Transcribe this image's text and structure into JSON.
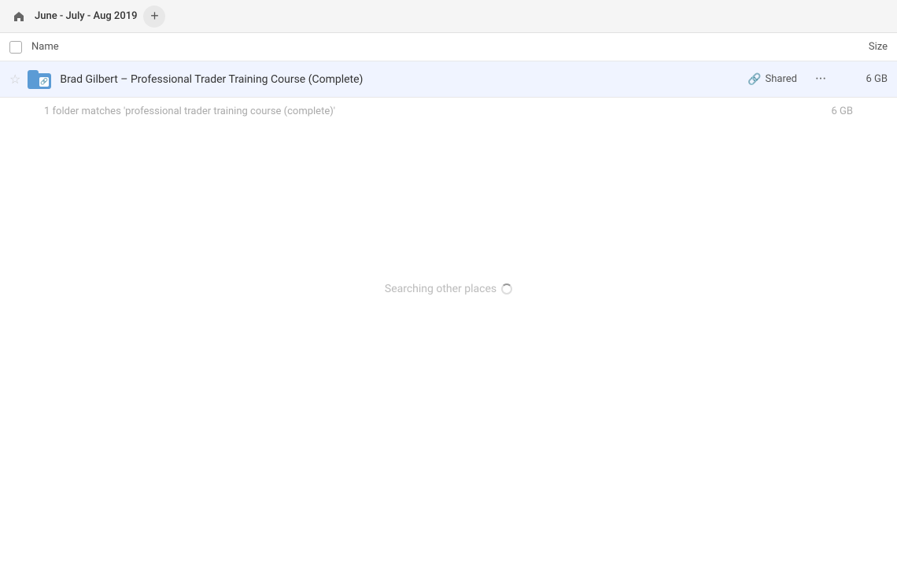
{
  "header": {
    "home_icon": "home",
    "breadcrumb_label": "June - July - Aug 2019",
    "add_button_label": "+"
  },
  "columns": {
    "name_label": "Name",
    "size_label": "Size"
  },
  "file_row": {
    "name": "Brad Gilbert – Professional Trader Training Course (Complete)",
    "shared_label": "Shared",
    "more_label": "···",
    "size": "6 GB"
  },
  "search_result": {
    "text": "1 folder matches 'professional trader training course (complete)'",
    "size": "6 GB"
  },
  "searching": {
    "text": "Searching other places"
  }
}
